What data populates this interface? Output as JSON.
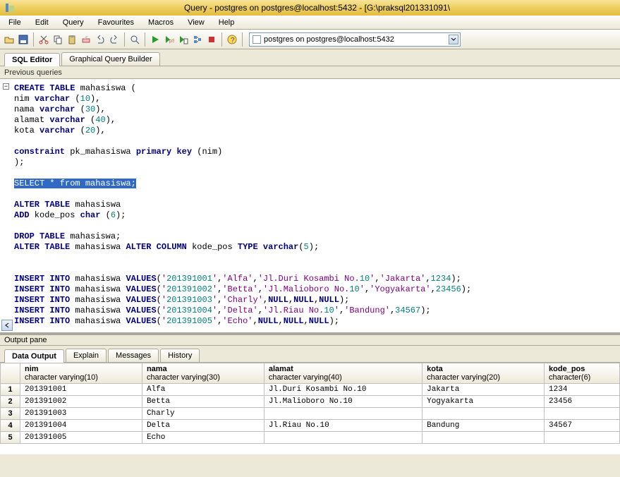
{
  "title": "Query - postgres on postgres@localhost:5432 - [G:\\praksql201331091\\",
  "menu": {
    "file": "File",
    "edit": "Edit",
    "query": "Query",
    "favourites": "Favourites",
    "macros": "Macros",
    "view": "View",
    "help": "Help"
  },
  "connection": "postgres on postgres@localhost:5432",
  "tabs": {
    "sql_editor": "SQL Editor",
    "gqb": "Graphical Query Builder"
  },
  "subbar": "Previous queries",
  "sql": {
    "l1": "CREATE TABLE mahasiswa (",
    "l2": "nim varchar (10),",
    "l3": "nama varchar (30),",
    "l4": "alamat varchar (40),",
    "l5": "kota varchar (20),",
    "l6": "",
    "l7": "constraint pk_mahasiswa primary key (nim)",
    "l8": ");",
    "l9": "",
    "l10": "SELECT * from mahasiswa;",
    "l11": "",
    "l12": "ALTER TABLE mahasiswa",
    "l13": "ADD kode_pos char (6);",
    "l14": "",
    "l15": "DROP TABLE mahasiswa;",
    "l16": "ALTER TABLE mahasiswa ALTER COLUMN kode_pos TYPE varchar(5);",
    "l17": "",
    "l18": "",
    "l19": "INSERT INTO mahasiswa VALUES('201391001','Alfa','Jl.Duri Kosambi No.10','Jakarta',1234);",
    "l20": "INSERT INTO mahasiswa VALUES('201391002','Betta','Jl.Malioboro No.10','Yogyakarta',23456);",
    "l21": "INSERT INTO mahasiswa VALUES('201391003','Charly',NULL,NULL,NULL);",
    "l22": "INSERT INTO mahasiswa VALUES('201391004','Delta','Jl.Riau No.10','Bandung',34567);",
    "l23": "INSERT INTO mahasiswa VALUES('201391005','Echo',NULL,NULL,NULL);"
  },
  "output_label": "Output pane",
  "outtabs": {
    "data_output": "Data Output",
    "explain": "Explain",
    "messages": "Messages",
    "history": "History"
  },
  "columns": [
    {
      "name": "nim",
      "type": "character varying(10)"
    },
    {
      "name": "nama",
      "type": "character varying(30)"
    },
    {
      "name": "alamat",
      "type": "character varying(40)"
    },
    {
      "name": "kota",
      "type": "character varying(20)"
    },
    {
      "name": "kode_pos",
      "type": "character(6)"
    }
  ],
  "rows": [
    {
      "n": "1",
      "nim": "201391001",
      "nama": "Alfa",
      "alamat": "Jl.Duri Kosambi No.10",
      "kota": "Jakarta",
      "kode_pos": "1234"
    },
    {
      "n": "2",
      "nim": "201391002",
      "nama": "Betta",
      "alamat": "Jl.Malioboro No.10",
      "kota": "Yogyakarta",
      "kode_pos": "23456"
    },
    {
      "n": "3",
      "nim": "201391003",
      "nama": "Charly",
      "alamat": "",
      "kota": "",
      "kode_pos": ""
    },
    {
      "n": "4",
      "nim": "201391004",
      "nama": "Delta",
      "alamat": "Jl.Riau No.10",
      "kota": "Bandung",
      "kode_pos": "34567"
    },
    {
      "n": "5",
      "nim": "201391005",
      "nama": "Echo",
      "alamat": "",
      "kota": "",
      "kode_pos": ""
    }
  ]
}
